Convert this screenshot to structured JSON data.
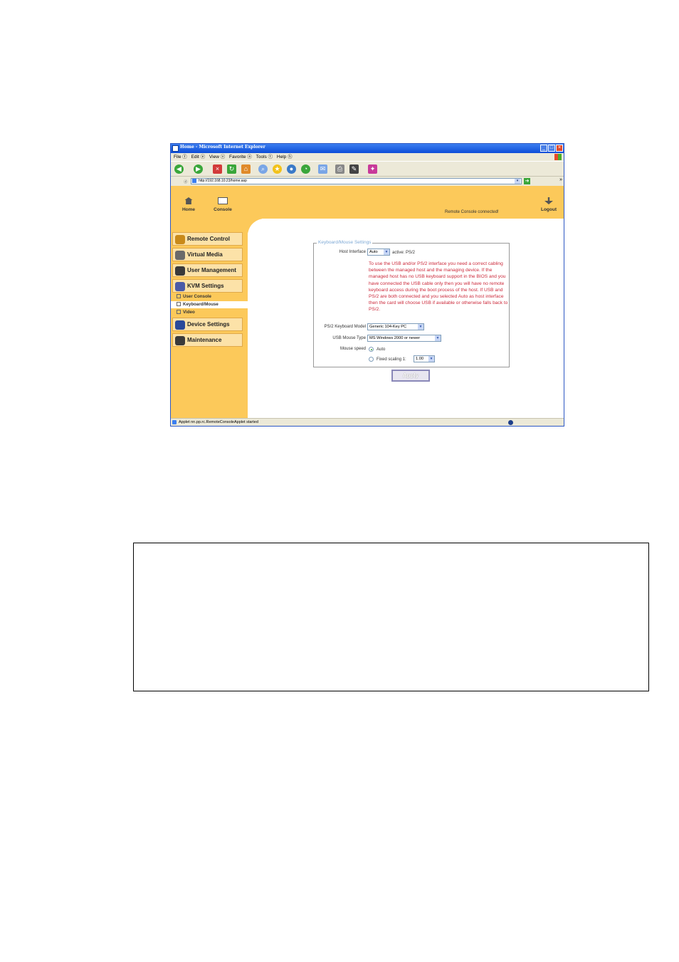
{
  "window": {
    "title": "Home - Microsoft Internet Explorer",
    "controls": {
      "minimize": "_",
      "maximize": "□",
      "close": "×"
    }
  },
  "menubar": {
    "items": [
      "File ⓕ",
      "Edit ⓔ",
      "View ⓥ",
      "Favorite ⓐ",
      "Tools ⓣ",
      "Help ⓗ"
    ]
  },
  "toolbar": {
    "icons": [
      "back-icon",
      "forward-icon",
      "stop-icon",
      "refresh-icon",
      "home-icon",
      "search-icon",
      "favorites-icon",
      "media-icon",
      "history-icon",
      "mail-icon",
      "print-icon",
      "edit-icon",
      "messenger-icon"
    ]
  },
  "address": {
    "label": "ⓓ",
    "url": "http://192.168.10.23/home.asp",
    "go_arrow": "➜",
    "dropdown": "▾",
    "more": "»"
  },
  "top_nav": {
    "home_label": "Home",
    "console_label": "Console",
    "status": "Remote Console connected!",
    "logout_label": "Logout"
  },
  "sidebar": {
    "items": [
      {
        "label": "Remote Control",
        "color": "#c98a1a"
      },
      {
        "label": "Virtual Media",
        "color": "#6a6a6a"
      },
      {
        "label": "User Management",
        "color": "#3a3a3a"
      },
      {
        "label": "KVM Settings",
        "color": "#4a5aa8"
      },
      {
        "label": "Device Settings",
        "color": "#2a4a9a"
      },
      {
        "label": "Maintenance",
        "color": "#3a3a3a"
      }
    ],
    "subitems": [
      "User Console",
      "Keyboard/Mouse",
      "Video"
    ]
  },
  "form": {
    "legend": "Keyboard/Mouse Settings",
    "host_interface_label": "Host Interface",
    "host_interface_value": "Auto",
    "active_text": "active: PS/2",
    "info_text": "To use the USB and/or PS/2 interface you need a correct cabling between the managed host and the managing device. If the managed host has no USB keyboard support in the BIOS and you have connected the USB cable only then you will have no remote keyboard access during the boot process of the host. If USB and PS/2 are both connected and you selected Auto as host interface then the card will choose USB if available or otherwise falls back to PS/2.",
    "ps2_model_label": "PS/2 Keyboard Model",
    "ps2_model_value": "Generic 104-Key PC",
    "usb_mouse_label": "USB Mouse Type",
    "usb_mouse_value": "MS Windows 2000 or newer",
    "mouse_speed_label": "Mouse speed",
    "speed_auto_label": "Auto",
    "speed_fixed_label": "Fixed scaling 1:",
    "scaling_value": "1.00",
    "apply_label": "Apply"
  },
  "statusbar": {
    "text": "Applet nn.pp.rc.RemoteConsoleApplet started"
  },
  "colors": {
    "accent": "#fcc95a",
    "info_red": "#cc2a3b",
    "legend_blue": "#7faad6"
  }
}
